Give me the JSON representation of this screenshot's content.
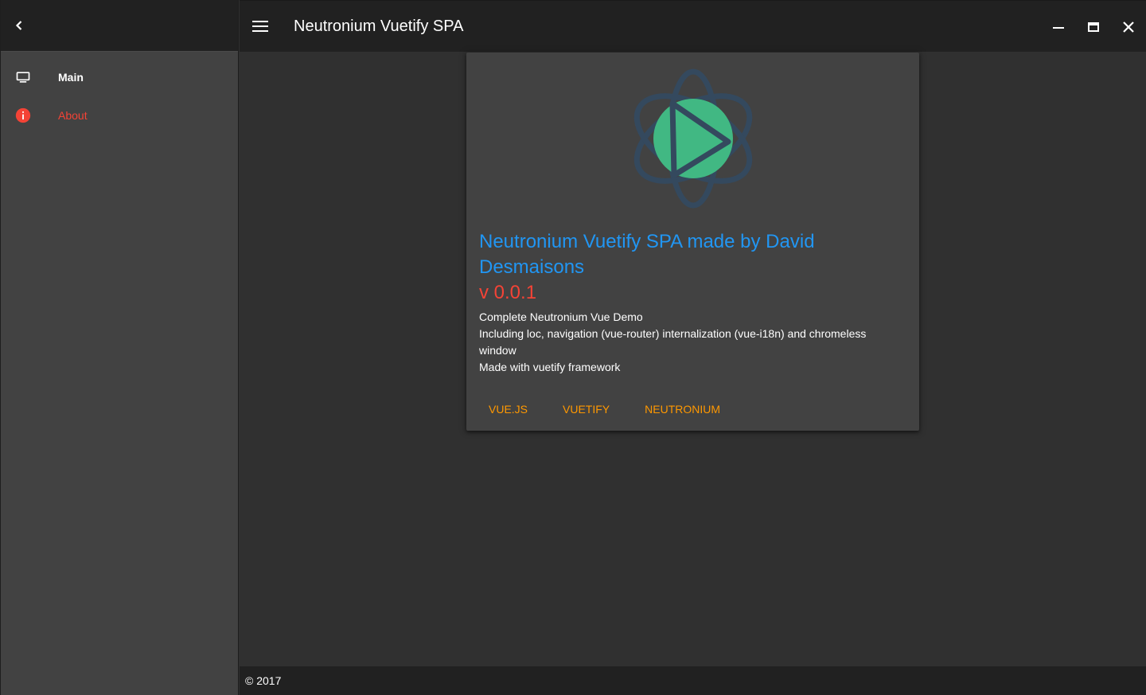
{
  "sidebar": {
    "back_icon": "chevron-left-icon",
    "items": [
      {
        "label": "Main",
        "icon": "desktop-icon"
      },
      {
        "label": "About",
        "icon": "info-icon",
        "color": "#f44336"
      }
    ]
  },
  "toolbar": {
    "menu_icon": "hamburger-menu-icon",
    "title": "Neutronium Vuetify SPA",
    "controls": [
      "minimize-icon",
      "maximize-icon",
      "close-icon"
    ]
  },
  "card": {
    "logo": "neutronium-logo",
    "title": "Neutronium Vuetify SPA made by David Desmaisons",
    "version": "v 0.0.1",
    "description": [
      "Complete Neutronium Vue Demo",
      "Including loc, navigation (vue-router) internalization (vue-i18n) and chromeless window",
      "Made with vuetify framework"
    ],
    "actions": [
      "VUE.JS",
      "VUETIFY",
      "NEUTRONIUM"
    ]
  },
  "footer": {
    "text": "© 2017"
  },
  "colors": {
    "primary": "#2196f3",
    "accent": "#f44336",
    "action": "#ff9800",
    "logo_green": "#41b883",
    "logo_navy": "#34495e"
  }
}
